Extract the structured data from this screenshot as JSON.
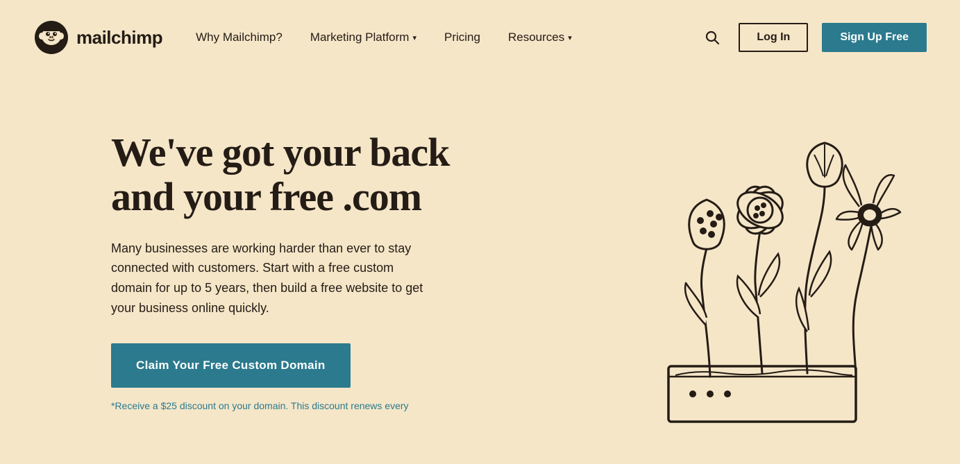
{
  "nav": {
    "logo_text": "mailchimp",
    "links": [
      {
        "label": "Why Mailchimp?",
        "has_dropdown": false
      },
      {
        "label": "Marketing Platform",
        "has_dropdown": true
      },
      {
        "label": "Pricing",
        "has_dropdown": false
      },
      {
        "label": "Resources",
        "has_dropdown": true
      }
    ],
    "login_label": "Log In",
    "signup_label": "Sign Up Free"
  },
  "hero": {
    "title_line1": "We've got your back",
    "title_line2": "and your free .com",
    "body": "Many businesses are working harder than ever to stay connected with customers. Start with a free custom domain for up to 5 years, then build a free website to get your business online quickly.",
    "cta_label": "Claim Your Free Custom Domain",
    "disclaimer": "*Receive a $25 discount on your domain. This discount renews every"
  },
  "colors": {
    "bg": "#f5e6c8",
    "brand_dark": "#241c15",
    "brand_teal": "#2b7a8e"
  }
}
